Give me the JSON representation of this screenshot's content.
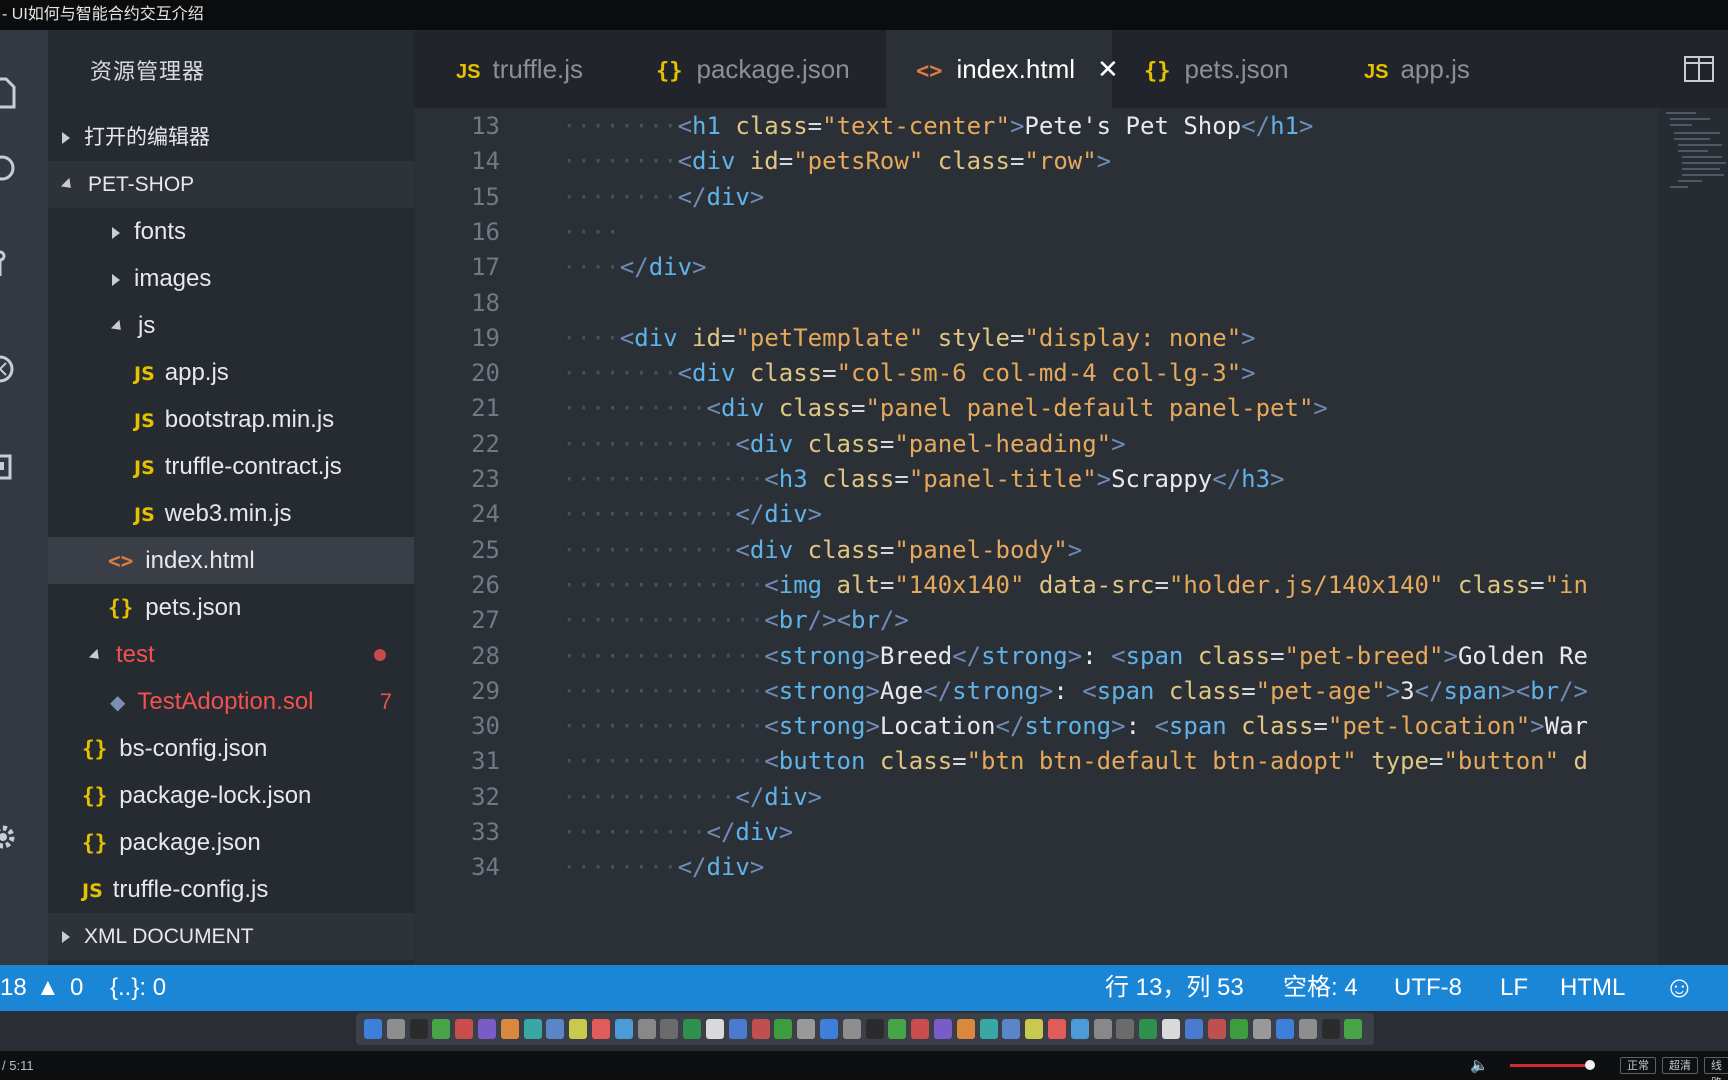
{
  "window": {
    "title": "- UI如何与智能合约交互介绍"
  },
  "sidebar": {
    "header": "资源管理器",
    "open_editors": "打开的编辑器",
    "project": "PET-SHOP",
    "tree": [
      {
        "label": "fonts"
      },
      {
        "label": "images"
      },
      {
        "label": "js"
      },
      {
        "label": "app.js",
        "icon": "JS"
      },
      {
        "label": "bootstrap.min.js",
        "icon": "JS"
      },
      {
        "label": "truffle-contract.js",
        "icon": "JS"
      },
      {
        "label": "web3.min.js",
        "icon": "JS"
      },
      {
        "label": "index.html",
        "icon": "<>"
      },
      {
        "label": "pets.json",
        "icon": "{}"
      },
      {
        "label": "test"
      },
      {
        "label": "TestAdoption.sol",
        "badge": "7"
      },
      {
        "label": "bs-config.json",
        "icon": "{}"
      },
      {
        "label": "package-lock.json",
        "icon": "{}"
      },
      {
        "label": "package.json",
        "icon": "{}"
      },
      {
        "label": "truffle-config.js",
        "icon": "JS"
      }
    ],
    "xml_section": "XML DOCUMENT"
  },
  "tabs": [
    {
      "label": "truffle.js",
      "icon": "JS"
    },
    {
      "label": "package.json",
      "icon": "{}"
    },
    {
      "label": "index.html",
      "icon": "<>",
      "close": "✕"
    },
    {
      "label": "pets.json",
      "icon": "{}"
    },
    {
      "label": "app.js",
      "icon": "JS"
    }
  ],
  "editor": {
    "lines": [
      {
        "n": "13",
        "text": "<h1 class=\"text-center\">Pete's Pet Shop</h1>"
      },
      {
        "n": "14",
        "text": "<div id=\"petsRow\" class=\"row\">"
      },
      {
        "n": "15",
        "text": "</div>"
      },
      {
        "n": "16",
        "text": ""
      },
      {
        "n": "17",
        "text": "</div>"
      },
      {
        "n": "18",
        "text": ""
      },
      {
        "n": "19",
        "text": "<div id=\"petTemplate\" style=\"display: none\">"
      },
      {
        "n": "20",
        "text": "<div class=\"col-sm-6 col-md-4 col-lg-3\">"
      },
      {
        "n": "21",
        "text": "<div class=\"panel panel-default panel-pet\">"
      },
      {
        "n": "22",
        "text": "<div class=\"panel-heading\">"
      },
      {
        "n": "23",
        "text": "<h3 class=\"panel-title\">Scrappy</h3>"
      },
      {
        "n": "24",
        "text": "</div>"
      },
      {
        "n": "25",
        "text": "<div class=\"panel-body\">"
      },
      {
        "n": "26",
        "text": "<img alt=\"140x140\" data-src=\"holder.js/140x140\" class=\"in"
      },
      {
        "n": "27",
        "text": "<br/><br/>"
      },
      {
        "n": "28",
        "text": "<strong>Breed</strong>: <span class=\"pet-breed\">Golden Re"
      },
      {
        "n": "29",
        "text": "<strong>Age</strong>: <span class=\"pet-age\">3</span><br/>"
      },
      {
        "n": "30",
        "text": "<strong>Location</strong>: <span class=\"pet-location\">War"
      },
      {
        "n": "31",
        "text": "<button class=\"btn btn-default btn-adopt\" type=\"button\" d"
      },
      {
        "n": "32",
        "text": "</div>"
      },
      {
        "n": "33",
        "text": "</div>"
      },
      {
        "n": "34",
        "text": "</div>"
      }
    ]
  },
  "status": {
    "errors": "18",
    "warnings": "0",
    "braces": "{..}: 0",
    "position": "行 13，列 53",
    "indent": "空格: 4",
    "encoding": "UTF-8",
    "eol": "LF",
    "language": "HTML"
  },
  "player": {
    "time": "/ 5:11",
    "buttons": [
      "正常",
      "超清",
      "线路"
    ]
  },
  "colors": {
    "statusbar": "#1b86d6",
    "sidebar": "#262a31",
    "editor": "#2b2f36",
    "error_text": "#f0524f"
  }
}
